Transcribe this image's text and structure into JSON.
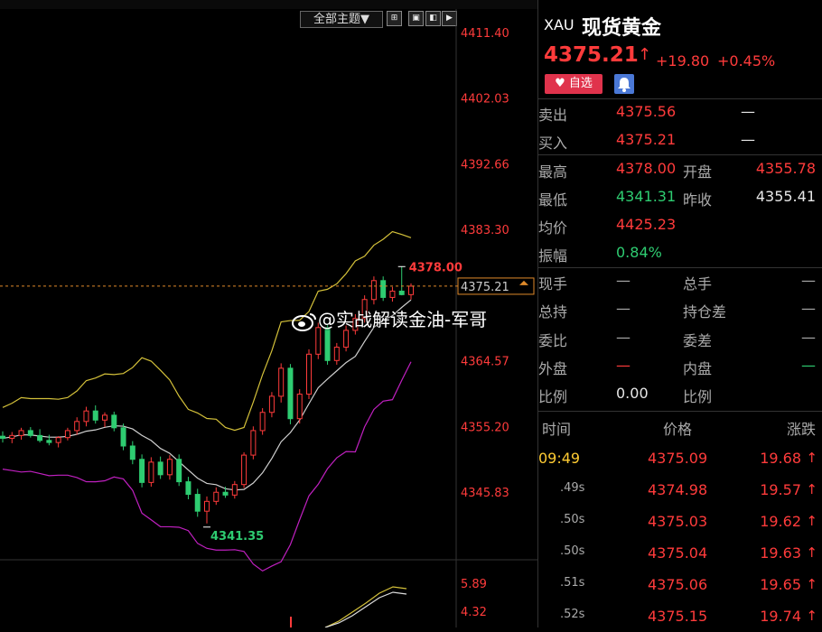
{
  "chart": {
    "theme_select": "全部主题▼",
    "price_axis": [
      "4411.40",
      "4402.03",
      "4392.66",
      "4383.30",
      "4364.57",
      "4355.20",
      "4345.83"
    ],
    "current_price_tag": "4375.21",
    "high_label": "4378.00",
    "low_label": "4341.35",
    "volume_axis": [
      "5.89",
      "4.32"
    ],
    "watermark": "@实战解读金油-军哥",
    "colors": {
      "up": "#ff3b3b",
      "down": "#2ecc71",
      "upper_band": "#d4c13a",
      "mid_band": "#cfcfcf",
      "lower_band": "#c020c0",
      "price_line": "#e08a2a"
    }
  },
  "chart_data": {
    "type": "candlestick",
    "candles": [
      [
        4353.8,
        4354.5,
        4352.9,
        4353.5
      ],
      [
        4353.5,
        4354.4,
        4352.8,
        4353.9
      ],
      [
        4353.9,
        4355.0,
        4353.3,
        4354.6
      ],
      [
        4354.6,
        4355.1,
        4353.6,
        4353.9
      ],
      [
        4353.9,
        4354.8,
        4352.9,
        4353.2
      ],
      [
        4353.2,
        4354.0,
        4352.5,
        4352.9
      ],
      [
        4352.9,
        4353.8,
        4352.2,
        4353.6
      ],
      [
        4353.6,
        4355.0,
        4353.2,
        4354.6
      ],
      [
        4354.6,
        4356.5,
        4354.0,
        4355.9
      ],
      [
        4355.9,
        4358.0,
        4355.2,
        4357.4
      ],
      [
        4357.4,
        4358.2,
        4355.6,
        4356.1
      ],
      [
        4356.1,
        4357.2,
        4355.1,
        4356.8
      ],
      [
        4356.8,
        4357.3,
        4354.5,
        4355.0
      ],
      [
        4355.0,
        4355.6,
        4351.8,
        4352.4
      ],
      [
        4352.4,
        4353.1,
        4349.8,
        4350.5
      ],
      [
        4350.5,
        4351.2,
        4346.5,
        4347.2
      ],
      [
        4347.2,
        4350.8,
        4346.6,
        4350.1
      ],
      [
        4350.1,
        4350.9,
        4347.7,
        4348.3
      ],
      [
        4348.3,
        4351.1,
        4347.6,
        4350.5
      ],
      [
        4350.5,
        4351.2,
        4346.7,
        4347.3
      ],
      [
        4347.3,
        4348.0,
        4344.8,
        4345.5
      ],
      [
        4345.5,
        4346.3,
        4342.3,
        4343.1
      ],
      [
        4343.1,
        4345.2,
        4341.35,
        4344.5
      ],
      [
        4344.5,
        4346.5,
        4344.0,
        4345.8
      ],
      [
        4345.8,
        4346.6,
        4345.0,
        4345.4
      ],
      [
        4345.4,
        4347.4,
        4344.9,
        4346.9
      ],
      [
        4346.9,
        4351.5,
        4346.4,
        4351.1
      ],
      [
        4351.1,
        4355.2,
        4350.5,
        4354.6
      ],
      [
        4354.6,
        4357.8,
        4354.0,
        4357.2
      ],
      [
        4357.2,
        4360.1,
        4356.5,
        4359.5
      ],
      [
        4359.5,
        4364.2,
        4358.6,
        4363.5
      ],
      [
        4363.5,
        4364.1,
        4355.5,
        4356.3
      ],
      [
        4356.3,
        4360.5,
        4355.6,
        4359.8
      ],
      [
        4359.8,
        4366.2,
        4359.1,
        4365.5
      ],
      [
        4365.5,
        4370.0,
        4364.8,
        4369.3
      ],
      [
        4369.3,
        4369.8,
        4364.0,
        4364.6
      ],
      [
        4364.6,
        4367.1,
        4364.0,
        4366.5
      ],
      [
        4366.5,
        4369.6,
        4365.9,
        4368.9
      ],
      [
        4368.9,
        4371.2,
        4368.3,
        4370.6
      ],
      [
        4370.6,
        4373.9,
        4370.0,
        4373.3
      ],
      [
        4373.3,
        4376.6,
        4372.6,
        4376.0
      ],
      [
        4376.0,
        4376.6,
        4373.1,
        4373.6
      ],
      [
        4373.6,
        4375.1,
        4373.0,
        4374.5
      ],
      [
        4374.5,
        4378.0,
        4373.9,
        4374.0
      ],
      [
        4374.0,
        4375.6,
        4373.3,
        4375.21
      ]
    ],
    "ylim": [
      4337.0,
      4414.0
    ],
    "current": 4375.21,
    "high": 4378.0,
    "low": 4341.35
  },
  "panel": {
    "symbol": "XAU",
    "name": "现货黄金",
    "price": "4375.21",
    "price_arrow": "↑",
    "change": "+19.80",
    "change_pct": "+0.45%",
    "fav_label": "自选",
    "quotes": [
      {
        "l1": "卖出",
        "v1": "4375.56",
        "c1": "red",
        "l2": "",
        "v2": "—",
        "c2": "white",
        "v1left": true
      },
      {
        "l1": "买入",
        "v1": "4375.21",
        "c1": "red",
        "l2": "",
        "v2": "—",
        "c2": "white",
        "v1left": true
      },
      {
        "l1": "最高",
        "v1": "4378.00",
        "c1": "red",
        "l2": "开盘",
        "v2": "4355.78",
        "c2": "red"
      },
      {
        "l1": "最低",
        "v1": "4341.31",
        "c1": "green",
        "l2": "昨收",
        "v2": "4355.41",
        "c2": "white"
      },
      {
        "l1": "均价",
        "v1": "4425.23",
        "c1": "red",
        "l2": "",
        "v2": "",
        "c2": "white"
      },
      {
        "l1": "振幅",
        "v1": "0.84%",
        "c1": "green",
        "l2": "",
        "v2": "",
        "c2": "white"
      },
      {
        "l1": "现手",
        "v1": "—",
        "c1": "grey",
        "l2": "总手",
        "v2": "—",
        "c2": "grey"
      },
      {
        "l1": "总持",
        "v1": "—",
        "c1": "grey",
        "l2": "持仓差",
        "v2": "—",
        "c2": "grey"
      },
      {
        "l1": "委比",
        "v1": "—",
        "c1": "grey",
        "l2": "委差",
        "v2": "—",
        "c2": "grey"
      },
      {
        "l1": "外盘",
        "v1": "—",
        "c1": "red",
        "l2": "内盘",
        "v2": "—",
        "c2": "green"
      },
      {
        "l1": "比例",
        "v1": "0.00",
        "c1": "white",
        "l2": "比例",
        "v2": "",
        "c2": "white"
      }
    ],
    "ticks_header": {
      "time": "时间",
      "price": "价格",
      "change": "涨跌"
    },
    "ticks": [
      {
        "time": "09:49",
        "price": "4375.09",
        "change": "19.68",
        "arrow": "↑",
        "main": true
      },
      {
        "time": ".49s",
        "price": "4374.98",
        "change": "19.57",
        "arrow": "↑",
        "main": false
      },
      {
        "time": ".50s",
        "price": "4375.03",
        "change": "19.62",
        "arrow": "↑",
        "main": false
      },
      {
        "time": ".50s",
        "price": "4375.04",
        "change": "19.63",
        "arrow": "↑",
        "main": false
      },
      {
        "time": ".51s",
        "price": "4375.06",
        "change": "19.65",
        "arrow": "↑",
        "main": false
      },
      {
        "time": ".52s",
        "price": "4375.15",
        "change": "19.74",
        "arrow": "↑",
        "main": false
      }
    ]
  }
}
